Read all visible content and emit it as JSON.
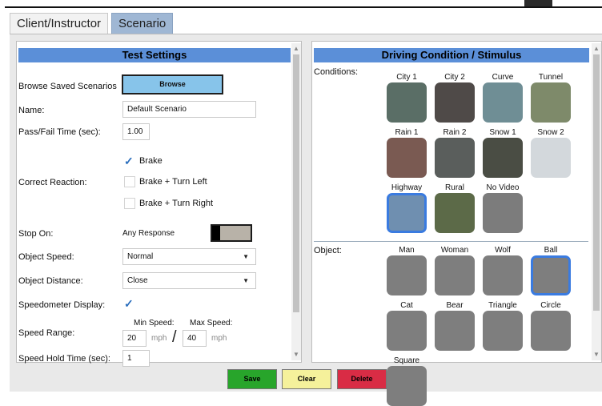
{
  "tabs": [
    {
      "label": "Client/Instructor",
      "active": false
    },
    {
      "label": "Scenario",
      "active": true
    }
  ],
  "test_settings": {
    "title": "Test Settings",
    "browse_label": "Browse Saved Scenarios",
    "browse_button": "Browse",
    "name_label": "Name:",
    "name_value": "Default Scenario",
    "passfail_label": "Pass/Fail Time (sec):",
    "passfail_value": "1.00",
    "correct_reaction_label": "Correct Reaction:",
    "reactions": [
      {
        "label": "Brake",
        "checked": true
      },
      {
        "label": "Brake + Turn Left",
        "checked": false
      },
      {
        "label": "Brake + Turn Right",
        "checked": false
      }
    ],
    "stop_on_label": "Stop On:",
    "stop_on_value": "Any Response",
    "object_speed_label": "Object Speed:",
    "object_speed_value": "Normal",
    "object_distance_label": "Object Distance:",
    "object_distance_value": "Close",
    "speedometer_label": "Speedometer Display:",
    "speedometer_checked": true,
    "speed_range_label": "Speed Range:",
    "min_speed_label": "Min Speed:",
    "max_speed_label": "Max Speed:",
    "min_speed_value": "20",
    "max_speed_value": "40",
    "unit": "mph",
    "slash": "/",
    "hold_time_label": "Speed Hold Time (sec):",
    "hold_time_value": "1"
  },
  "driving": {
    "title": "Driving Condition / Stimulus",
    "conditions_label": "Conditions:",
    "conditions": [
      {
        "label": "City 1",
        "color": "#5a6e66",
        "selected": false
      },
      {
        "label": "City 2",
        "color": "#4f4a48",
        "selected": false
      },
      {
        "label": "Curve",
        "color": "#6f8e95",
        "selected": false
      },
      {
        "label": "Tunnel",
        "color": "#7e8a6a",
        "selected": false
      },
      {
        "label": "Rain 1",
        "color": "#7a5a52",
        "selected": false
      },
      {
        "label": "Rain 2",
        "color": "#5a5e5c",
        "selected": false
      },
      {
        "label": "Snow 1",
        "color": "#4a4d44",
        "selected": false
      },
      {
        "label": "Snow 2",
        "color": "#d3d8dc",
        "selected": false
      },
      {
        "label": "Highway",
        "color": "#6f8fb0",
        "selected": true
      },
      {
        "label": "Rural",
        "color": "#5c6a48",
        "selected": false
      },
      {
        "label": "No Video",
        "color": "#7c7c7c",
        "selected": false
      }
    ],
    "object_label": "Object:",
    "objects": [
      {
        "label": "Man",
        "color": "#7e7e7e",
        "selected": false
      },
      {
        "label": "Woman",
        "color": "#7e7e7e",
        "selected": false
      },
      {
        "label": "Wolf",
        "color": "#7e7e7e",
        "selected": false
      },
      {
        "label": "Ball",
        "color": "#7e7e7e",
        "selected": true
      },
      {
        "label": "Cat",
        "color": "#7e7e7e",
        "selected": false
      },
      {
        "label": "Bear",
        "color": "#7e7e7e",
        "selected": false
      },
      {
        "label": "Triangle",
        "color": "#7e7e7e",
        "selected": false
      },
      {
        "label": "Circle",
        "color": "#7e7e7e",
        "selected": false
      },
      {
        "label": "Square",
        "color": "#7e7e7e",
        "selected": false
      }
    ]
  },
  "actions": {
    "save": "Save",
    "clear": "Clear",
    "delete": "Delete"
  }
}
